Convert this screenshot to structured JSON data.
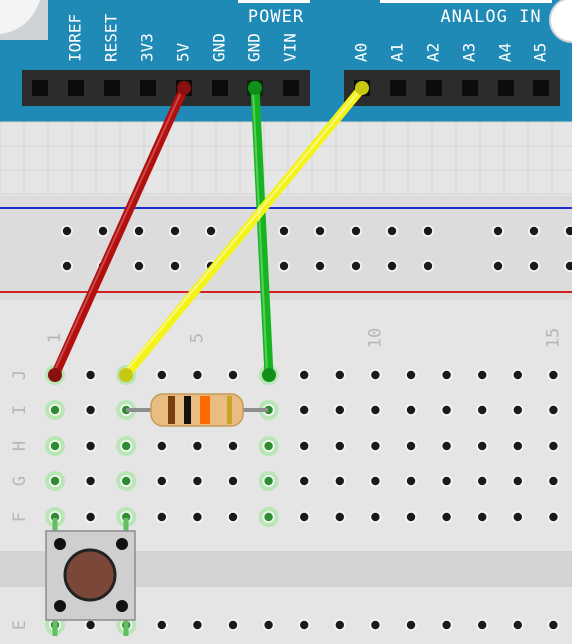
{
  "arduino": {
    "board_color": "#1f8ab5",
    "power_group_label": "POWER",
    "analog_group_label": "ANALOG IN",
    "power_pins": [
      "IOREF",
      "RESET",
      "3V3",
      "5V",
      "GND",
      "GND",
      "VIN"
    ],
    "analog_pins": [
      "A0",
      "A1",
      "A2",
      "A3",
      "A4",
      "A5"
    ]
  },
  "breadboard": {
    "column_numbers": [
      "1",
      "5",
      "10",
      "15"
    ],
    "row_letters": [
      "J",
      "I",
      "H",
      "G",
      "F",
      "E"
    ],
    "rail_blue_color": "#1a2fd0",
    "rail_red_color": "#d21f1f"
  },
  "wires": [
    {
      "name": "red-wire-5v",
      "from_pin": "5V",
      "to_hole": "J1",
      "color": "#b30f0f"
    },
    {
      "name": "green-wire-gnd",
      "from_pin": "GND",
      "to_hole": "J7",
      "color": "#16b51f"
    },
    {
      "name": "yellow-wire-a0",
      "from_pin": "A0",
      "to_hole": "J3",
      "color": "#f3f31a"
    }
  ],
  "components": {
    "resistor": {
      "from_hole": "I3",
      "to_hole": "I7",
      "bands": [
        "#7a3d10",
        "#111111",
        "#ff6a00",
        "#c9a227"
      ]
    },
    "pushbutton": {
      "cap_color": "#7a4738"
    }
  }
}
